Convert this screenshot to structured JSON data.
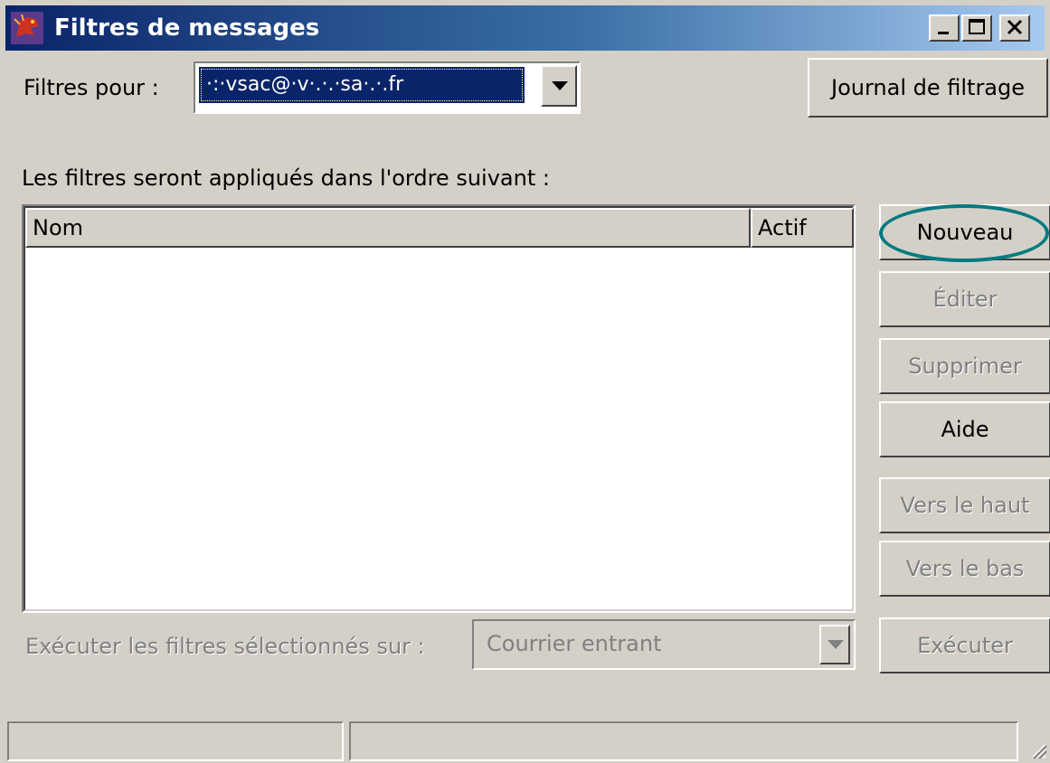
{
  "window": {
    "title": "Filtres de messages",
    "title_buttons": [
      "minimize-icon",
      "maximize-icon",
      "close-icon"
    ],
    "app_icon": "dragon-icon"
  },
  "top": {
    "filters_for_label": "Filtres pour :",
    "account_value": "·:·vsac@·v·.·.·sa·.·.fr",
    "journal_button": "Journal de filtrage"
  },
  "list": {
    "heading": "Les filtres seront appliqués dans l'ordre suivant :",
    "columns": [
      "Nom",
      "Actif"
    ],
    "rows": []
  },
  "side_buttons": {
    "nouveau": "Nouveau",
    "editer": "Éditer",
    "supprimer": "Supprimer",
    "aide": "Aide",
    "vers_le_haut": "Vers le haut",
    "vers_le_bas": "Vers le bas"
  },
  "bottom": {
    "run_label": "Exécuter les filtres sélectionnés sur :",
    "folder_value": "Courrier entrant",
    "run_button": "Exécuter"
  },
  "status_bar": {
    "pane1": "",
    "pane2": ""
  },
  "colors": {
    "titlebar_start": "#0a246a",
    "titlebar_end": "#a6caf0",
    "highlight_ring": "#007a80",
    "window_bg": "#d4d0c8"
  }
}
